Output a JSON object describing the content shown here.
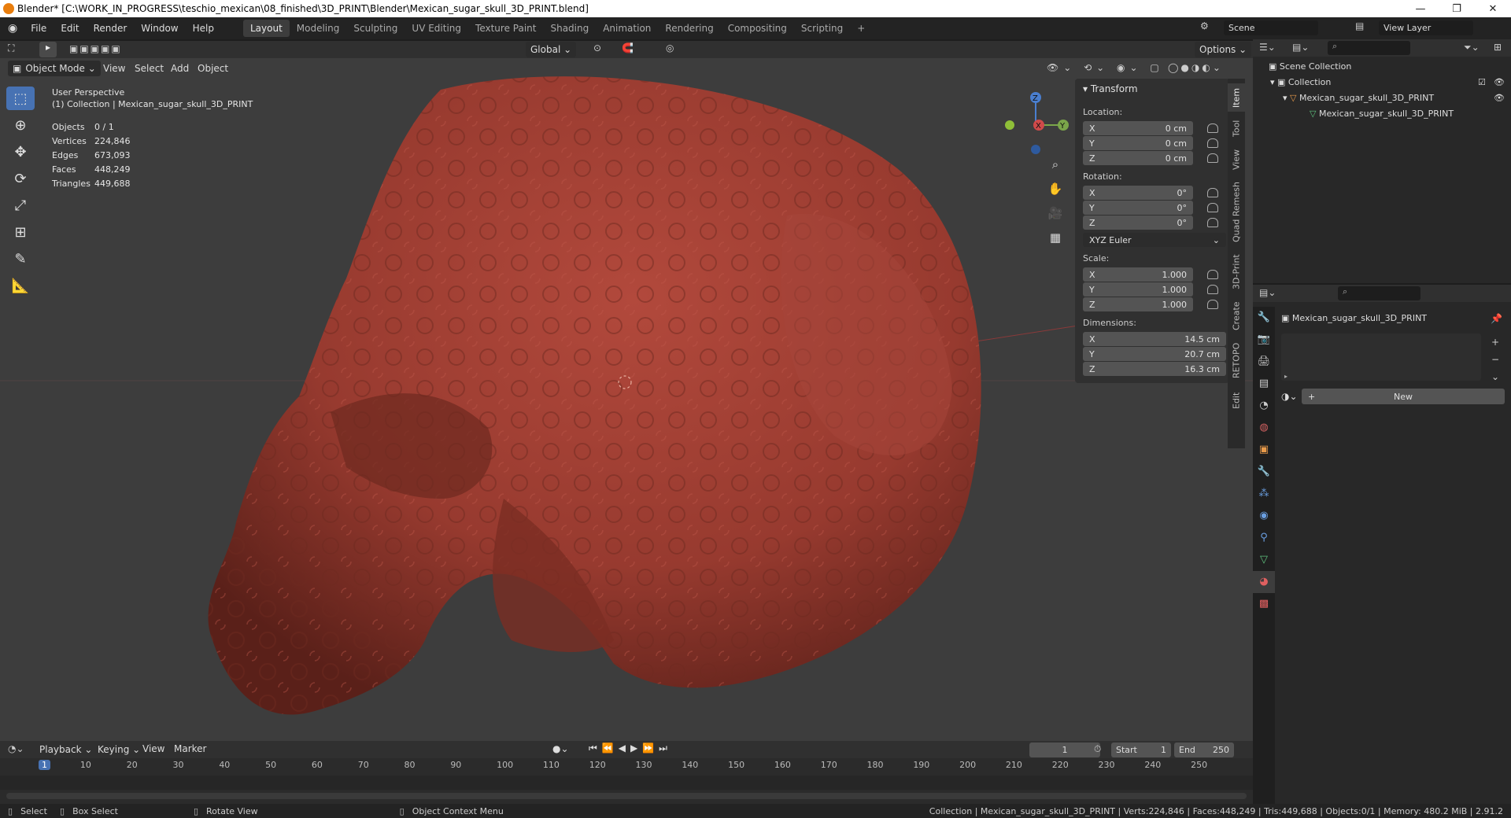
{
  "window": {
    "title": "Blender* [C:\\WORK_IN_PROGRESS\\teschio_mexican\\08_finished\\3D_PRINT\\Blender\\Mexican_sugar_skull_3D_PRINT.blend]"
  },
  "menu": [
    "File",
    "Edit",
    "Render",
    "Window",
    "Help"
  ],
  "workspaces": [
    "Layout",
    "Modeling",
    "Sculpting",
    "UV Editing",
    "Texture Paint",
    "Shading",
    "Animation",
    "Rendering",
    "Compositing",
    "Scripting"
  ],
  "active_workspace": "Layout",
  "scene": {
    "name": "Scene",
    "view_layer": "View Layer"
  },
  "viewport_header": {
    "mode": "Object Mode",
    "menus": [
      "View",
      "Select",
      "Add",
      "Object"
    ],
    "orientation": "Global",
    "options": "Options"
  },
  "overlay": {
    "perspective": "User Perspective",
    "collection": "(1) Collection | Mexican_sugar_skull_3D_PRINT",
    "stats": [
      {
        "label": "Objects",
        "value": "0 / 1"
      },
      {
        "label": "Vertices",
        "value": "224,846"
      },
      {
        "label": "Edges",
        "value": "673,093"
      },
      {
        "label": "Faces",
        "value": "448,249"
      },
      {
        "label": "Triangles",
        "value": "449,688"
      }
    ]
  },
  "gizmo": {
    "x": "X",
    "y": "Y",
    "z": "Z"
  },
  "transform": {
    "title": "Transform",
    "location_label": "Location:",
    "location": [
      {
        "axis": "X",
        "value": "0 cm"
      },
      {
        "axis": "Y",
        "value": "0 cm"
      },
      {
        "axis": "Z",
        "value": "0 cm"
      }
    ],
    "rotation_label": "Rotation:",
    "rotation": [
      {
        "axis": "X",
        "value": "0°"
      },
      {
        "axis": "Y",
        "value": "0°"
      },
      {
        "axis": "Z",
        "value": "0°"
      }
    ],
    "rotation_mode": "XYZ Euler",
    "scale_label": "Scale:",
    "scale": [
      {
        "axis": "X",
        "value": "1.000"
      },
      {
        "axis": "Y",
        "value": "1.000"
      },
      {
        "axis": "Z",
        "value": "1.000"
      }
    ],
    "dimensions_label": "Dimensions:",
    "dimensions": [
      {
        "axis": "X",
        "value": "14.5 cm"
      },
      {
        "axis": "Y",
        "value": "20.7 cm"
      },
      {
        "axis": "Z",
        "value": "16.3 cm"
      }
    ]
  },
  "sidebar_tabs": [
    "Item",
    "Tool",
    "View",
    "Quad Remesh",
    "3D-Print",
    "Create",
    "RETOPO",
    "Edit"
  ],
  "outliner": {
    "items": [
      "Scene Collection",
      "Collection",
      "Mexican_sugar_skull_3D_PRINT",
      "Mexican_sugar_skull_3D_PRINT"
    ]
  },
  "properties": {
    "object_name": "Mexican_sugar_skull_3D_PRINT",
    "new_button": "New"
  },
  "timeline": {
    "menus": [
      "Playback",
      "Keying",
      "View",
      "Marker"
    ],
    "current_frame": "1",
    "start_label": "Start",
    "start": "1",
    "end_label": "End",
    "end": "250",
    "ticks": [
      "1",
      "10",
      "20",
      "30",
      "40",
      "50",
      "60",
      "70",
      "80",
      "90",
      "100",
      "110",
      "120",
      "130",
      "140",
      "150",
      "160",
      "170",
      "180",
      "190",
      "200",
      "210",
      "220",
      "230",
      "240",
      "250"
    ]
  },
  "statusbar": {
    "select": "Select",
    "box_select": "Box Select",
    "rotate_view": "Rotate View",
    "context_menu": "Object Context Menu",
    "info": "Collection | Mexican_sugar_skull_3D_PRINT | Verts:224,846 | Faces:448,249 | Tris:449,688 | Objects:0/1 | Memory: 480.2 MiB | 2.91.2"
  },
  "colors": {
    "accent": "#4772b3",
    "skull": "#9b3b30",
    "viewport_bg": "#3d3d3d"
  }
}
